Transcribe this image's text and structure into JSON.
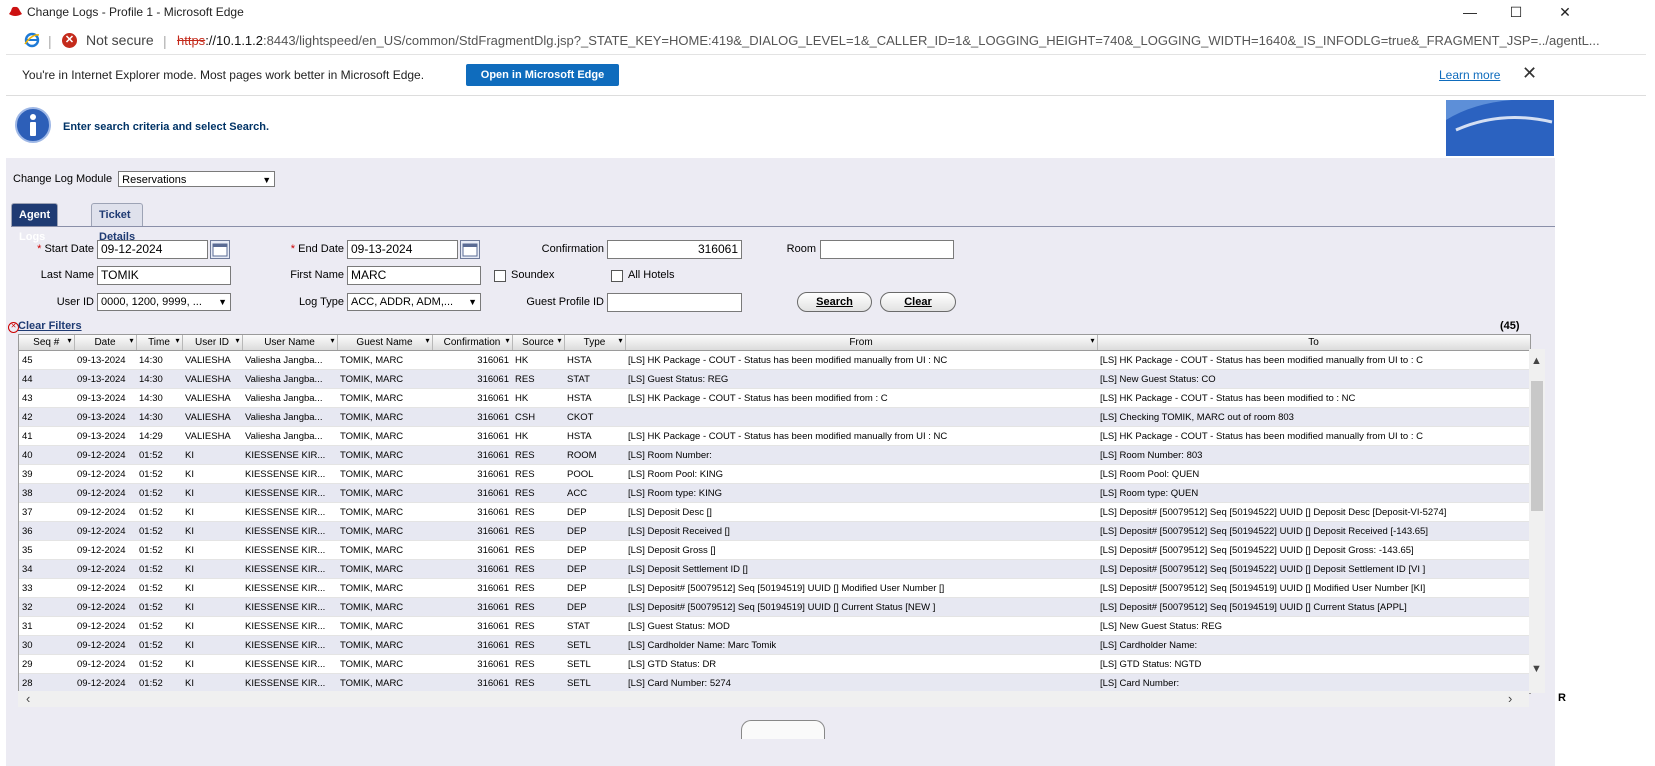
{
  "window": {
    "title": "Change Logs - Profile 1 - Microsoft Edge",
    "minimize": "—",
    "maximize": "☐",
    "close": "✕"
  },
  "address": {
    "not_secure": "Not secure",
    "url_scheme": "https",
    "url_rest_host": "://10.1.1.2",
    "url_rest": ":8443/lightspeed/en_US/common/StdFragmentDlg.jsp?_STATE_KEY=HOME:419&_DIALOG_LEVEL=1&_CALLER_ID=1&_LOGGING_HEIGHT=740&_LOGGING_WIDTH=1640&_IS_INFODLG=true&_FRAGMENT_JSP=../agentL..."
  },
  "ie_bar": {
    "message": "You're in Internet Explorer mode. Most pages work better in Microsoft Edge.",
    "open_button": "Open in Microsoft Edge",
    "learn_more": "Learn more",
    "close": "✕"
  },
  "info": {
    "message": "Enter search criteria and select Search."
  },
  "module": {
    "label": "Change Log Module",
    "value": "Reservations"
  },
  "tabs": [
    {
      "label": "Agent Logs"
    },
    {
      "label": "Ticket Details"
    }
  ],
  "form": {
    "start_date_label": "Start Date",
    "start_date": "09-12-2024",
    "end_date_label": "End Date",
    "end_date": "09-13-2024",
    "confirmation_label": "Confirmation",
    "confirmation": "316061",
    "room_label": "Room",
    "room": "",
    "last_name_label": "Last Name",
    "last_name": "TOMIK",
    "first_name_label": "First Name",
    "first_name": "MARC",
    "soundex_label": "Soundex",
    "all_hotels_label": "All Hotels",
    "user_id_label": "User ID",
    "user_id": "0000, 1200, 9999, ...",
    "log_type_label": "Log Type",
    "log_type": "ACC, ADDR, ADM,...",
    "guest_profile_label": "Guest Profile ID",
    "guest_profile": "",
    "search_button": "Search",
    "clear_button": "Clear",
    "required_mark": "*"
  },
  "results": {
    "clear_filters": "Clear Filters",
    "count": "(45)",
    "headers": [
      "Seq #",
      "Date",
      "Time",
      "User ID",
      "User Name",
      "Guest Name",
      "Confirmation",
      "Source",
      "Type",
      "From",
      "To"
    ],
    "rows": [
      [
        "45",
        "09-13-2024",
        "14:30",
        "VALIESHA",
        "Valiesha Jangba...",
        "TOMIK, MARC",
        "316061",
        "HK",
        "HSTA",
        "[LS] HK Package - COUT - Status has been modified manually from UI : NC",
        "[LS] HK Package - COUT - Status has been modified manually from UI to : C"
      ],
      [
        "44",
        "09-13-2024",
        "14:30",
        "VALIESHA",
        "Valiesha Jangba...",
        "TOMIK, MARC",
        "316061",
        "RES",
        "STAT",
        "[LS] Guest Status: REG",
        "[LS] New Guest Status: CO"
      ],
      [
        "43",
        "09-13-2024",
        "14:30",
        "VALIESHA",
        "Valiesha Jangba...",
        "TOMIK, MARC",
        "316061",
        "HK",
        "HSTA",
        "[LS] HK Package - COUT - Status has been modified from : C",
        "[LS] HK Package - COUT - Status has been modified to : NC"
      ],
      [
        "42",
        "09-13-2024",
        "14:30",
        "VALIESHA",
        "Valiesha Jangba...",
        "TOMIK, MARC",
        "316061",
        "CSH",
        "CKOT",
        "",
        "[LS] Checking TOMIK, MARC out of room 803"
      ],
      [
        "41",
        "09-13-2024",
        "14:29",
        "VALIESHA",
        "Valiesha Jangba...",
        "TOMIK, MARC",
        "316061",
        "HK",
        "HSTA",
        "[LS] HK Package - COUT - Status has been modified manually from UI : NC",
        "[LS] HK Package - COUT - Status has been modified manually from UI to : C"
      ],
      [
        "40",
        "09-12-2024",
        "01:52",
        "KI",
        "KIESSENSE KIR...",
        "TOMIK, MARC",
        "316061",
        "RES",
        "ROOM",
        "[LS] Room Number:",
        "[LS] Room Number: 803"
      ],
      [
        "39",
        "09-12-2024",
        "01:52",
        "KI",
        "KIESSENSE KIR...",
        "TOMIK, MARC",
        "316061",
        "RES",
        "POOL",
        "[LS] Room Pool: KING",
        "[LS] Room Pool: QUEN"
      ],
      [
        "38",
        "09-12-2024",
        "01:52",
        "KI",
        "KIESSENSE KIR...",
        "TOMIK, MARC",
        "316061",
        "RES",
        "ACC",
        "[LS] Room type: KING",
        "[LS] Room type: QUEN"
      ],
      [
        "37",
        "09-12-2024",
        "01:52",
        "KI",
        "KIESSENSE KIR...",
        "TOMIK, MARC",
        "316061",
        "RES",
        "DEP",
        "[LS] Deposit Desc []",
        "[LS] Deposit# [50079512] Seq [50194522] UUID [] Deposit Desc [Deposit-VI-5274]"
      ],
      [
        "36",
        "09-12-2024",
        "01:52",
        "KI",
        "KIESSENSE KIR...",
        "TOMIK, MARC",
        "316061",
        "RES",
        "DEP",
        "[LS] Deposit Received []",
        "[LS] Deposit# [50079512] Seq [50194522] UUID [] Deposit Received [-143.65]"
      ],
      [
        "35",
        "09-12-2024",
        "01:52",
        "KI",
        "KIESSENSE KIR...",
        "TOMIK, MARC",
        "316061",
        "RES",
        "DEP",
        "[LS] Deposit Gross []",
        "[LS] Deposit# [50079512] Seq [50194522] UUID [] Deposit Gross: -143.65]"
      ],
      [
        "34",
        "09-12-2024",
        "01:52",
        "KI",
        "KIESSENSE KIR...",
        "TOMIK, MARC",
        "316061",
        "RES",
        "DEP",
        "[LS] Deposit Settlement ID []",
        "[LS] Deposit# [50079512] Seq [50194522] UUID [] Deposit Settlement ID [VI ]"
      ],
      [
        "33",
        "09-12-2024",
        "01:52",
        "KI",
        "KIESSENSE KIR...",
        "TOMIK, MARC",
        "316061",
        "RES",
        "DEP",
        "[LS] Deposit# [50079512] Seq [50194519] UUID [] Modified User Number []",
        "[LS] Deposit# [50079512] Seq [50194519] UUID [] Modified User Number [KI]"
      ],
      [
        "32",
        "09-12-2024",
        "01:52",
        "KI",
        "KIESSENSE KIR...",
        "TOMIK, MARC",
        "316061",
        "RES",
        "DEP",
        "[LS] Deposit# [50079512] Seq [50194519] UUID [] Current Status [NEW ]",
        "[LS] Deposit# [50079512] Seq [50194519] UUID [] Current Status [APPL]"
      ],
      [
        "31",
        "09-12-2024",
        "01:52",
        "KI",
        "KIESSENSE KIR...",
        "TOMIK, MARC",
        "316061",
        "RES",
        "STAT",
        "[LS] Guest Status: MOD",
        "[LS] New Guest Status: REG"
      ],
      [
        "30",
        "09-12-2024",
        "01:52",
        "KI",
        "KIESSENSE KIR...",
        "TOMIK, MARC",
        "316061",
        "RES",
        "SETL",
        "[LS] Cardholder Name: Marc Tomik",
        "[LS] Cardholder Name:"
      ],
      [
        "29",
        "09-12-2024",
        "01:52",
        "KI",
        "KIESSENSE KIR...",
        "TOMIK, MARC",
        "316061",
        "RES",
        "SETL",
        "[LS] GTD Status: DR",
        "[LS] GTD Status: NGTD"
      ],
      [
        "28",
        "09-12-2024",
        "01:52",
        "KI",
        "KIESSENSE KIR...",
        "TOMIK, MARC",
        "316061",
        "RES",
        "SETL",
        "[LS] Card Number: 5274",
        "[LS] Card Number:"
      ]
    ]
  },
  "edge_right": {
    "r_letter": "R"
  }
}
